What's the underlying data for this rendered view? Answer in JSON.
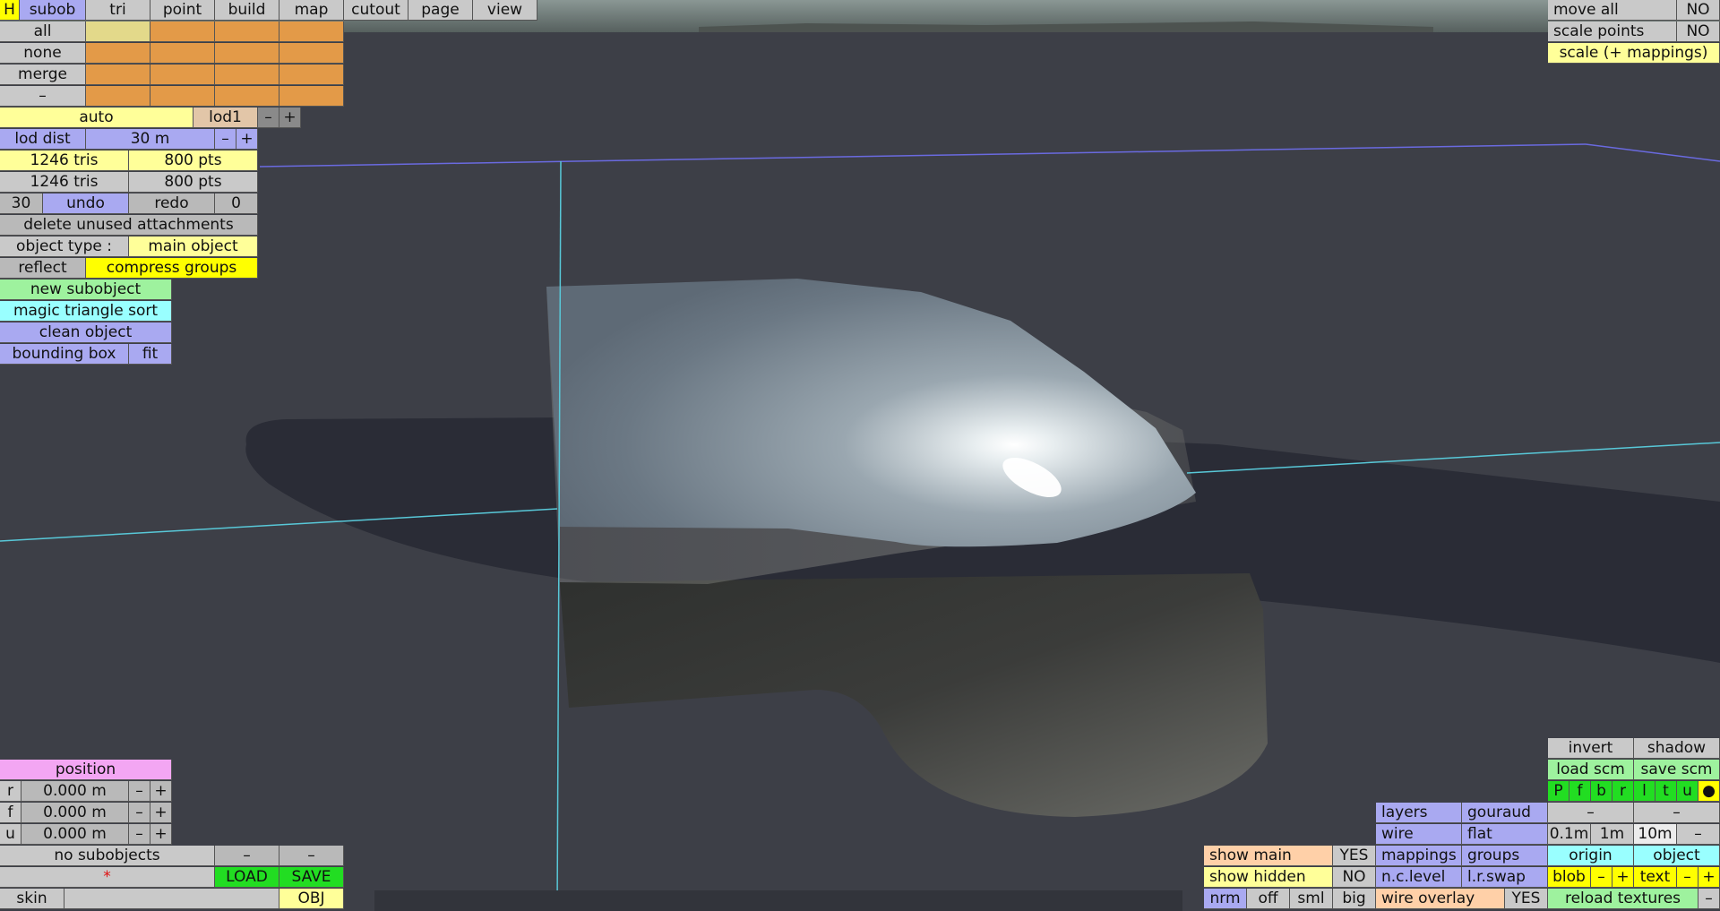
{
  "menu": {
    "h": "H",
    "tabs": [
      "subob",
      "tri",
      "point",
      "build",
      "map",
      "cutout",
      "page",
      "view"
    ]
  },
  "select_rows": [
    "all",
    "none",
    "merge",
    "–"
  ],
  "lod": {
    "auto": "auto",
    "lod": "lod1",
    "minus": "–",
    "plus": "+",
    "dist_label": "lod dist",
    "dist_value": "30 m"
  },
  "stats": {
    "row1_tris": "1246 tris",
    "row1_pts": "800 pts",
    "row2_tris": "1246 tris",
    "row2_pts": "800 pts"
  },
  "history": {
    "undo_count": "30",
    "undo": "undo",
    "redo": "redo",
    "redo_count": "0"
  },
  "ops": {
    "delete_unused": "delete unused attachments",
    "object_type_label": "object type :",
    "object_type_value": "main object",
    "reflect": "reflect",
    "compress_groups": "compress groups",
    "new_subobject": "new subobject",
    "magic_sort": "magic triangle sort",
    "clean_object": "clean object",
    "bounding_box": "bounding box",
    "fit": "fit"
  },
  "top_right": {
    "move_all": "move all",
    "move_all_val": "NO",
    "scale_points": "scale points",
    "scale_points_val": "NO",
    "scale_mappings": "scale (+ mappings)"
  },
  "position": {
    "title": "position",
    "rows": [
      {
        "axis": "r",
        "value": "0.000 m"
      },
      {
        "axis": "f",
        "value": "0.000 m"
      },
      {
        "axis": "u",
        "value": "0.000 m"
      }
    ],
    "minus": "–",
    "plus": "+"
  },
  "subobjects": {
    "label": "no subobjects",
    "dash1": "–",
    "dash2": "–",
    "star": "*",
    "load": "LOAD",
    "save": "SAVE",
    "skin": "skin",
    "obj": "OBJ"
  },
  "view_panel": {
    "show_main": "show main",
    "show_main_val": "YES",
    "show_hidden": "show hidden",
    "show_hidden_val": "NO",
    "nrm": "nrm",
    "off": "off",
    "sml": "sml",
    "big": "big",
    "layers": "layers",
    "gouraud": "gouraud",
    "wire": "wire",
    "flat": "flat",
    "mappings": "mappings",
    "groups": "groups",
    "nclevel": "n.c.level",
    "lrswap": "l.r.swap",
    "wire_overlay": "wire overlay",
    "wire_overlay_val": "YES"
  },
  "right_panel": {
    "invert": "invert",
    "shadow": "shadow",
    "load_scm": "load scm",
    "save_scm": "save scm",
    "dirs": [
      "P",
      "f",
      "b",
      "r",
      "l",
      "t",
      "u",
      "●"
    ],
    "dash1": "–",
    "dash2": "–",
    "g01": "0.1m",
    "g1": "1m",
    "g10": "10m",
    "gminus": "–",
    "origin": "origin",
    "object": "object",
    "blob": "blob",
    "blob_minus": "–",
    "blob_plus": "+",
    "text": "text",
    "text_minus": "–",
    "text_plus": "+",
    "reload": "reload textures",
    "reload_minus": "–"
  },
  "colors": {
    "background": "#3d3f47",
    "shadow": "#2a2c36",
    "axis": "#58c8d8",
    "grid": "#6a6ae0"
  }
}
